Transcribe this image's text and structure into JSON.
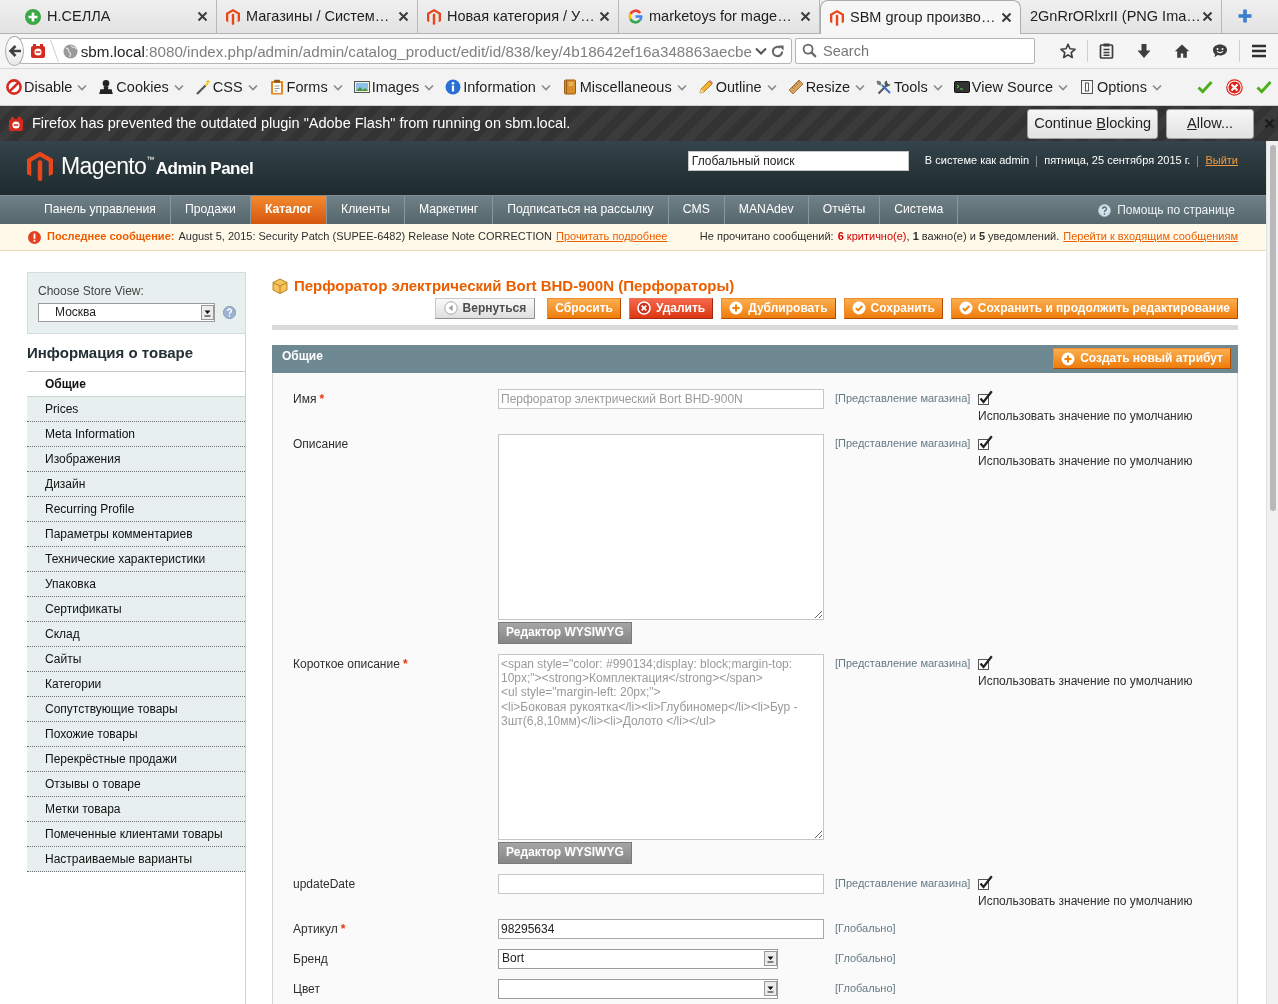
{
  "browser": {
    "tabs": [
      {
        "label": "Н.СЕЛЛА",
        "selected": false
      },
      {
        "label": "Магазины / Систем…",
        "selected": false
      },
      {
        "label": "Новая категория / У…",
        "selected": false
      },
      {
        "label": "marketoys for mage…",
        "selected": false
      },
      {
        "label": "SBM group произво…",
        "selected": true
      },
      {
        "label": "2GnRrORlxrII (PNG Ima…",
        "selected": false
      }
    ],
    "url": {
      "host": "sbm.local",
      "rest": ":8080/index.php/admin/admin/catalog_product/edit/id/838/key/4b18642ef16a348863aecbe"
    },
    "search": {
      "placeholder": "Search"
    }
  },
  "dev_toolbar": {
    "menus": [
      {
        "label": "Disable"
      },
      {
        "label": "Cookies"
      },
      {
        "label": "CSS"
      },
      {
        "label": "Forms"
      },
      {
        "label": "Images"
      },
      {
        "label": "Information"
      },
      {
        "label": "Miscellaneous"
      },
      {
        "label": "Outline"
      },
      {
        "label": "Resize"
      },
      {
        "label": "Tools"
      },
      {
        "label": "View Source"
      },
      {
        "label": "Options"
      }
    ]
  },
  "plugin_notice": {
    "message": "Firefox has prevented the outdated plugin \"Adobe Flash\" from running on sbm.local.",
    "buttons": [
      {
        "before": "Continue ",
        "access_key": "B",
        "after": "locking"
      },
      {
        "access_key": "A",
        "after": "llow..."
      }
    ]
  },
  "header": {
    "logo": "Magento$^{™}$",
    "logo_suffix": "Admin Panel",
    "search": {
      "value": "Глобальный поиск"
    },
    "user": "В системе как admin",
    "date": "пятница, 25 сентября 2015 г.",
    "logout": "Выйти"
  },
  "menu": {
    "items": [
      {
        "label": "Панель управления",
        "selected": false
      },
      {
        "label": "Продажи",
        "selected": false
      },
      {
        "label": "Каталог",
        "selected": true
      },
      {
        "label": "Клиенты",
        "selected": false
      },
      {
        "label": "Маркетинг",
        "selected": false
      },
      {
        "label": "Подписаться на рассылку",
        "selected": false
      },
      {
        "label": "CMS",
        "selected": false
      },
      {
        "label": "MANAdev",
        "selected": false
      },
      {
        "label": "Отчёты",
        "selected": false
      },
      {
        "label": "Система",
        "selected": false
      }
    ],
    "help": "Помощь по странице"
  },
  "notice": {
    "label": "Последнее сообщение:",
    "text": "August 5, 2015: Security Patch (SUPEE-6482) Release Note CORRECTION",
    "link": "Прочитать подробнее",
    "unread_prefix": "Не прочитано сообщений:",
    "unread_critical": "**6** критично(е)",
    "unread_rest": ", **1** важно(е) и **5** уведомлений.",
    "inbox_link": "Перейти к входящим сообщениям"
  },
  "sidebar": {
    "store_label": "Choose Store View:",
    "store_value": "Москва",
    "title": "Информация о товаре",
    "tabs": [
      {
        "label": "Общие",
        "selected": true
      },
      {
        "label": "Prices",
        "selected": false
      },
      {
        "label": "Meta Information",
        "selected": false
      },
      {
        "label": "Изображения",
        "selected": false
      },
      {
        "label": "Дизайн",
        "selected": false
      },
      {
        "label": "Recurring Profile",
        "selected": false
      },
      {
        "label": "Параметры комментариев",
        "selected": false
      },
      {
        "label": "Технические характеристики",
        "selected": false
      },
      {
        "label": "Упаковка",
        "selected": false
      },
      {
        "label": "Сертификаты",
        "selected": false
      },
      {
        "label": "Склад",
        "selected": false
      },
      {
        "label": "Сайты",
        "selected": false
      },
      {
        "label": "Категории",
        "selected": false
      },
      {
        "label": "Сопутствующие товары",
        "selected": false
      },
      {
        "label": "Похожие товары",
        "selected": false
      },
      {
        "label": "Перекрёстные продажи",
        "selected": false
      },
      {
        "label": "Отзывы о товаре",
        "selected": false
      },
      {
        "label": "Метки товара",
        "selected": false
      },
      {
        "label": "Помеченные клиентами товары",
        "selected": false
      },
      {
        "label": "Настраиваемые варианты",
        "selected": false
      }
    ]
  },
  "product": {
    "title": "Перфоратор электрический Bort BHD-900N (Перфораторы)",
    "buttons": [
      {
        "kind": "back",
        "label": "Вернуться"
      },
      {
        "kind": "reset",
        "label": "Сбросить"
      },
      {
        "kind": "delete",
        "label": "Удалить"
      },
      {
        "kind": "duplicate",
        "label": "Дублировать"
      },
      {
        "kind": "save",
        "label": "Сохранить"
      },
      {
        "kind": "save_continue",
        "label": "Сохранить и продолжить редактирование"
      }
    ]
  },
  "fieldset": {
    "title": "Общие",
    "button": {
      "kind": "create",
      "label": "Создать новый атрибут"
    },
    "fields": [
      {
        "kind": "text",
        "label": "Имя",
        "required_mark": "*",
        "value": "Перфоратор электрический Bort BHD-900N",
        "disabled": true,
        "scope": "[Представление магазина]",
        "use_default": {
          "label": "Использовать значение по умолчанию",
          "checked": true
        }
      },
      {
        "kind": "textarea",
        "label": "Описание",
        "disabled": true,
        "wysiwyg": "Редактор WYSIWYG",
        "scope": "[Представление магазина]",
        "use_default": {
          "label": "Использовать значение по умолчанию",
          "checked": true
        }
      },
      {
        "kind": "textarea",
        "label": "Короткое описание",
        "required_mark": "*",
        "value": "<span style=\"color: #990134;display: block;margin-top: 10px;\"><strong>Комплектация</strong></span>\n<ul style=\"margin-left: 20px;\">\n<li>Боковая рукоятка</li><li>Глубиномер</li><li>Бур - 3шт(6,8,10мм)</li><li>Долото </li></ul>",
        "disabled": true,
        "wysiwyg": "Редактор WYSIWYG",
        "scope": "[Представление магазина]",
        "use_default": {
          "label": "Использовать значение по умолчанию",
          "checked": true
        }
      },
      {
        "kind": "text",
        "label": "updateDate",
        "disabled": true,
        "scope": "[Представление магазина]",
        "use_default": {
          "label": "Использовать значение по умолчанию",
          "checked": true
        }
      },
      {
        "kind": "text",
        "label": "Артикул",
        "required_mark": "*",
        "value": "98295634",
        "disabled": false,
        "scope": "[Глобально]"
      },
      {
        "kind": "select",
        "label": "Бренд",
        "value": "Bort",
        "disabled": false,
        "scope": "[Глобально]"
      },
      {
        "kind": "select",
        "label": "Цвет",
        "disabled": false,
        "scope": "[Глобально]"
      }
    ]
  }
}
